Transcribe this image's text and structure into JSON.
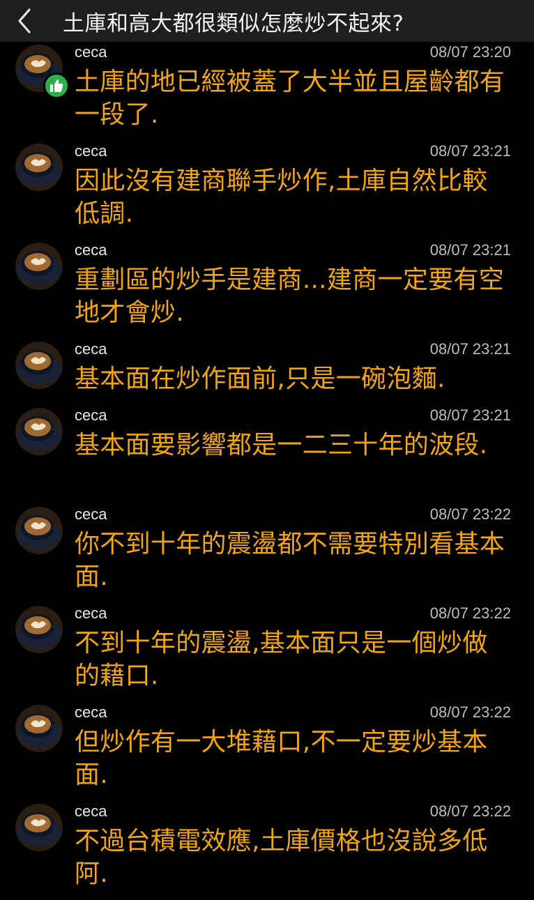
{
  "header": {
    "title": "土庫和高大都很類似怎麼炒不起來?",
    "back_icon": "chevron-left-icon"
  },
  "colors": {
    "accent_text": "#f1a512",
    "header_bg": "#1e1e1e",
    "badge_green": "#2bb24a"
  },
  "posts": [
    {
      "user": "ceca",
      "time": "08/07 23:20",
      "text": "土庫的地已經被蓋了大半並且屋齡都有一段了.",
      "badge": "thumbs-up-icon"
    },
    {
      "user": "ceca",
      "time": "08/07 23:21",
      "text": "因此沒有建商聯手炒作,土庫自然比較低調."
    },
    {
      "user": "ceca",
      "time": "08/07 23:21",
      "text": "重劃區的炒手是建商...建商一定要有空地才會炒."
    },
    {
      "user": "ceca",
      "time": "08/07 23:21",
      "text": "基本面在炒作面前,只是一碗泡麵."
    },
    {
      "user": "ceca",
      "time": "08/07 23:21",
      "text": "基本面要影響都是一二三十年的波段."
    },
    {
      "user": "ceca",
      "time": "08/07 23:22",
      "text": "你不到十年的震盪都不需要特別看基本面."
    },
    {
      "user": "ceca",
      "time": "08/07 23:22",
      "text": "不到十年的震盪,基本面只是一個炒做的藉口."
    },
    {
      "user": "ceca",
      "time": "08/07 23:22",
      "text": "但炒作有一大堆藉口,不一定要炒基本面."
    },
    {
      "user": "ceca",
      "time": "08/07 23:22",
      "text": "不過台積電效應,土庫價格也沒說多低阿."
    }
  ]
}
